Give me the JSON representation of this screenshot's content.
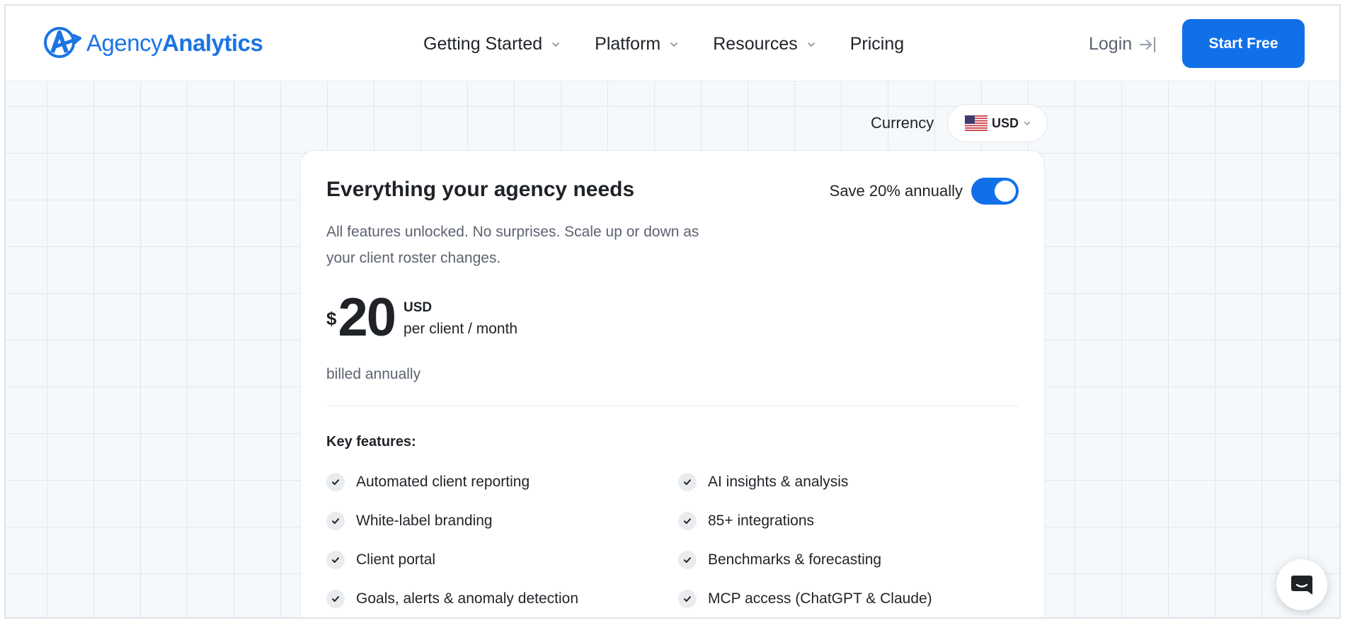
{
  "brand": {
    "name_light": "Agency",
    "name_bold": "Analytics",
    "color": "#1b74e4"
  },
  "nav": {
    "items": [
      {
        "label": "Getting Started",
        "has_dropdown": true
      },
      {
        "label": "Platform",
        "has_dropdown": true
      },
      {
        "label": "Resources",
        "has_dropdown": true
      },
      {
        "label": "Pricing",
        "has_dropdown": false
      }
    ],
    "login_label": "Login",
    "cta_label": "Start Free",
    "cta_color": "#1170e8"
  },
  "currency": {
    "label": "Currency",
    "selected": "USD",
    "flag_icon": "us-flag-icon"
  },
  "plan": {
    "title": "Everything your agency needs",
    "save_label": "Save 20% annually",
    "annual_toggle_on": true,
    "description": "All features unlocked. No surprises. Scale up or down as your client roster changes.",
    "currency_symbol": "$",
    "amount": "20",
    "currency_code": "USD",
    "unit": "per client / month",
    "billing_note": "billed annually",
    "features_title": "Key features:",
    "features": [
      "Automated client reporting",
      "AI insights & analysis",
      "White-label branding",
      "85+ integrations",
      "Client portal",
      "Benchmarks & forecasting",
      "Goals, alerts & anomaly detection",
      "MCP access (ChatGPT & Claude)"
    ]
  },
  "chat": {
    "icon": "chat-icon"
  }
}
